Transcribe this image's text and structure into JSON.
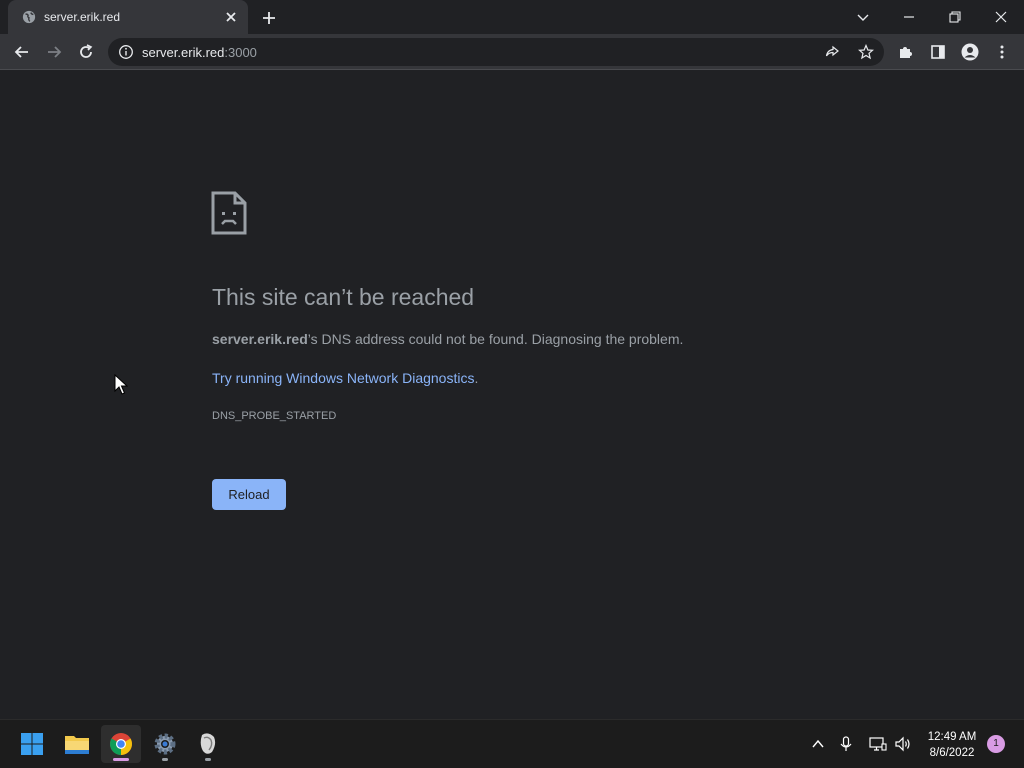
{
  "browser": {
    "tab": {
      "title": "server.erik.red"
    },
    "omnibox": {
      "host": "server.erik.red",
      "port": ":3000"
    }
  },
  "error_page": {
    "title": "This site can’t be reached",
    "host_bold": "server.erik.red",
    "description": "’s DNS address could not be found. Diagnosing the problem.",
    "suggestion_link": "Try running Windows Network Diagnostics",
    "suggestion_suffix": ".",
    "error_code": "DNS_PROBE_STARTED",
    "reload_label": "Reload"
  },
  "taskbar": {
    "apps": [
      "windows-start",
      "file-explorer",
      "chrome",
      "settings",
      "app-unknown"
    ],
    "clock": {
      "time": "12:49 AM",
      "date": "8/6/2022"
    },
    "notification_count": "1"
  },
  "colors": {
    "background": "#202124",
    "toolbar": "#35363a",
    "link": "#8ab4f8",
    "text": "#9aa0a6",
    "taskbar": "#1c1c1c",
    "notification": "#d99ce4"
  }
}
